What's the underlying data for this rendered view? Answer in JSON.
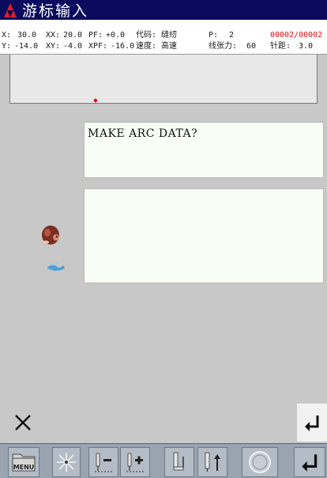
{
  "app": {
    "title": "游标输入"
  },
  "status": {
    "x_label": "X:",
    "x_value": "30.0",
    "xx_label": "XX:",
    "xx_value": "20.0",
    "pf_label": "PF:",
    "pf_value": "+0.0",
    "code_label": "代码:",
    "code_value": "缝纫",
    "p_label": "P:",
    "p_value": "2",
    "counter": "00002/00002",
    "y_label": "Y:",
    "y_value": "-14.0",
    "xy_label": "XY:",
    "xy_value": "-4.0",
    "xpf_label": "XPF:",
    "xpf_value": "-16.0",
    "speed_label": "速度:",
    "speed_value": "高速",
    "tension_label": "线张力:",
    "tension_value": "60",
    "stitch_label": "针距:",
    "stitch_value": "3.0"
  },
  "dialog": {
    "message": "MAKE ARC DATA?",
    "input_value": ""
  },
  "toolbar": {
    "menu_label": "MENU"
  },
  "colors": {
    "titlebar": "#0a0a5e",
    "accent": "#e01010",
    "panel": "#f8fdf6"
  }
}
